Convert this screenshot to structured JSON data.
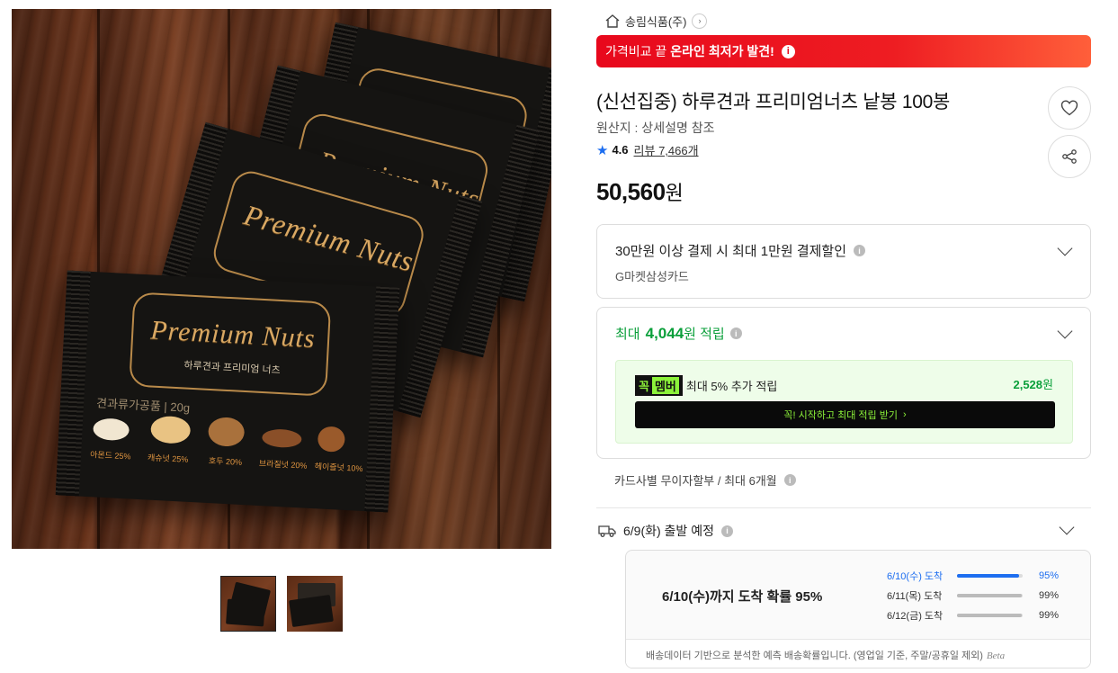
{
  "store": {
    "name": "송림식품(주)",
    "home_icon": "home-icon",
    "chevron_icon": "chevron-right-icon"
  },
  "promo": {
    "prefix": "가격비교 끝",
    "highlight": "온라인 최저가 발견!",
    "info_icon": "info-icon",
    "colors": {
      "start": "#e8081c",
      "end": "#ff5f3a"
    }
  },
  "product": {
    "title": "(신선집중) 하루견과 프리미엄너츠 낱봉 100봉",
    "origin": "원산지 : 상세설명 참조",
    "rating": "4.6",
    "review_label": "리뷰 7,466개",
    "price": "50,560",
    "price_unit": "원"
  },
  "image": {
    "package_brand": "Premium Nuts",
    "package_sub": "하루견과 프리미엄 너츠",
    "package_weight": "견과류가공품 | 20g",
    "nuts": [
      "아몬드 25%",
      "캐슈넛 25%",
      "호두 20%",
      "브라질넛 20%",
      "헤이즐넛 10%"
    ]
  },
  "thumbnails": [
    {
      "label": "thumbnail-1",
      "active": true
    },
    {
      "label": "thumbnail-2",
      "active": false
    }
  ],
  "actions": {
    "wishlist_icon": "heart-icon",
    "share_icon": "share-icon"
  },
  "discount": {
    "title": "30만원 이상 결제 시 최대 1만원 결제할인",
    "card": "G마켓삼성카드"
  },
  "points": {
    "prefix": "최대",
    "amount": "4,044",
    "suffix": "원 적립",
    "member": {
      "badge_a": "꼭",
      "badge_b": "멤버",
      "text": "최대 5% 추가 적립",
      "amount": "2,528",
      "amount_unit": "원",
      "button": "꼭! 시작하고 최대 적립 받기",
      "button_arrow": "›"
    },
    "color": "#0a9f3a"
  },
  "installment": "카드사별 무이자할부 / 최대 6개월",
  "shipping": {
    "label": "6/9(화) 출발 예정",
    "headline": "6/10(수)까지 도착 확률 95%",
    "rows": [
      {
        "date": "6/10(수) 도착",
        "percent": "95%",
        "value": 0.95,
        "highlight": true
      },
      {
        "date": "6/11(목) 도착",
        "percent": "99%",
        "value": 0.99,
        "highlight": false
      },
      {
        "date": "6/12(금) 도착",
        "percent": "99%",
        "value": 0.99,
        "highlight": false
      }
    ],
    "footnote": "배송데이터 기반으로 분석한 예측 배송확률입니다. (영업일 기준, 주말/공휴일 제외)",
    "beta": "Beta",
    "accent": "#1d6ef0"
  }
}
